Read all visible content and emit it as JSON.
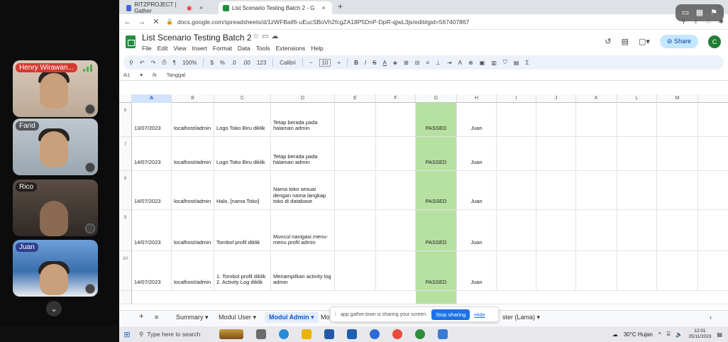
{
  "participants": [
    {
      "id": "henry",
      "name": "Henry Wirawan..."
    },
    {
      "id": "farid",
      "name": "Farid"
    },
    {
      "id": "rico",
      "name": "Rico"
    },
    {
      "id": "juan",
      "name": "Juan"
    }
  ],
  "browser": {
    "tabs": [
      {
        "label": "RITZPROJECT | Gather"
      },
      {
        "label": "List Scenario Testing Batch 2 - G"
      }
    ],
    "url": "docs.google.com/spreadsheets/d/1zWFBaif6-uEucSBoVh2fcgZA18P5DnP-DpR-qjwL3js/edit#gid=567407867"
  },
  "sheet": {
    "title": "List Scenario Testing Batch 2",
    "menus": [
      "File",
      "Edit",
      "View",
      "Insert",
      "Format",
      "Data",
      "Tools",
      "Extensions",
      "Help"
    ],
    "share_label": "Share",
    "account_initial": "C",
    "toolbar": {
      "zoom": "100%",
      "currency": "$",
      "percent": "%",
      "dec_dec": ".0",
      "inc_dec": ".00",
      "format_num": "123",
      "font": "Calibri",
      "font_size": "10",
      "minus": "−",
      "plus": "+"
    },
    "formula_bar": {
      "cell_ref": "A1",
      "fx": "fx",
      "content": "Tanggal"
    },
    "columns": [
      "A",
      "B",
      "C",
      "D",
      "E",
      "F",
      "G",
      "H",
      "I",
      "J",
      "K",
      "L",
      "M"
    ],
    "rows": [
      {
        "num": "6",
        "date": "13/07/2023",
        "url": "localhost/admin",
        "action": "Logo Toko Biru diklik",
        "expected": "Tetap berada pada halaman admin",
        "status": "PASSED",
        "tester": "Juan"
      },
      {
        "num": "7",
        "date": "14/07/2023",
        "url": "localhost/admin",
        "action": "Logo Toko Biru diklik",
        "expected": "Tetap berada pada halaman admin",
        "status": "PASSED",
        "tester": "Juan"
      },
      {
        "num": "8",
        "date": "14/07/2023",
        "url": "localhost/admin",
        "action": "Halo, [nama Toko]",
        "expected": "Nama toko sesuai dengan nama langkap toko di database",
        "status": "PASSED",
        "tester": "Juan"
      },
      {
        "num": "9",
        "date": "14/07/2023",
        "url": "localhost/admin",
        "action": "Tombol profil diklik",
        "expected": "Muncul navigasi menu-menu profil admin",
        "status": "PASSED",
        "tester": "Juan"
      },
      {
        "num": "10",
        "date": "14/07/2023",
        "url": "localhost/admin",
        "action": "1. Tombol profil diklik 2. Activity Log diklik",
        "expected": "Menampilkan activity log admin",
        "status": "PASSED",
        "tester": "Juan"
      }
    ],
    "sheet_tabs": {
      "add": "+",
      "all": "≡",
      "summary": "Summary ▾",
      "modul_user": "Modul User ▾",
      "modul_admin": "Modul Admin ▾",
      "partial": "Moc",
      "master_lama": "ster (Lama) ▾",
      "scroll": "‹"
    }
  },
  "share_popup": {
    "message": "app.gather.town is sharing your screen.",
    "stop_label": "Stop sharing",
    "hide_label": "Hide"
  },
  "taskbar": {
    "search_placeholder": "Type here to search",
    "weather": "30°C Hujan",
    "time": "12:01",
    "date": "25/11/2023"
  }
}
